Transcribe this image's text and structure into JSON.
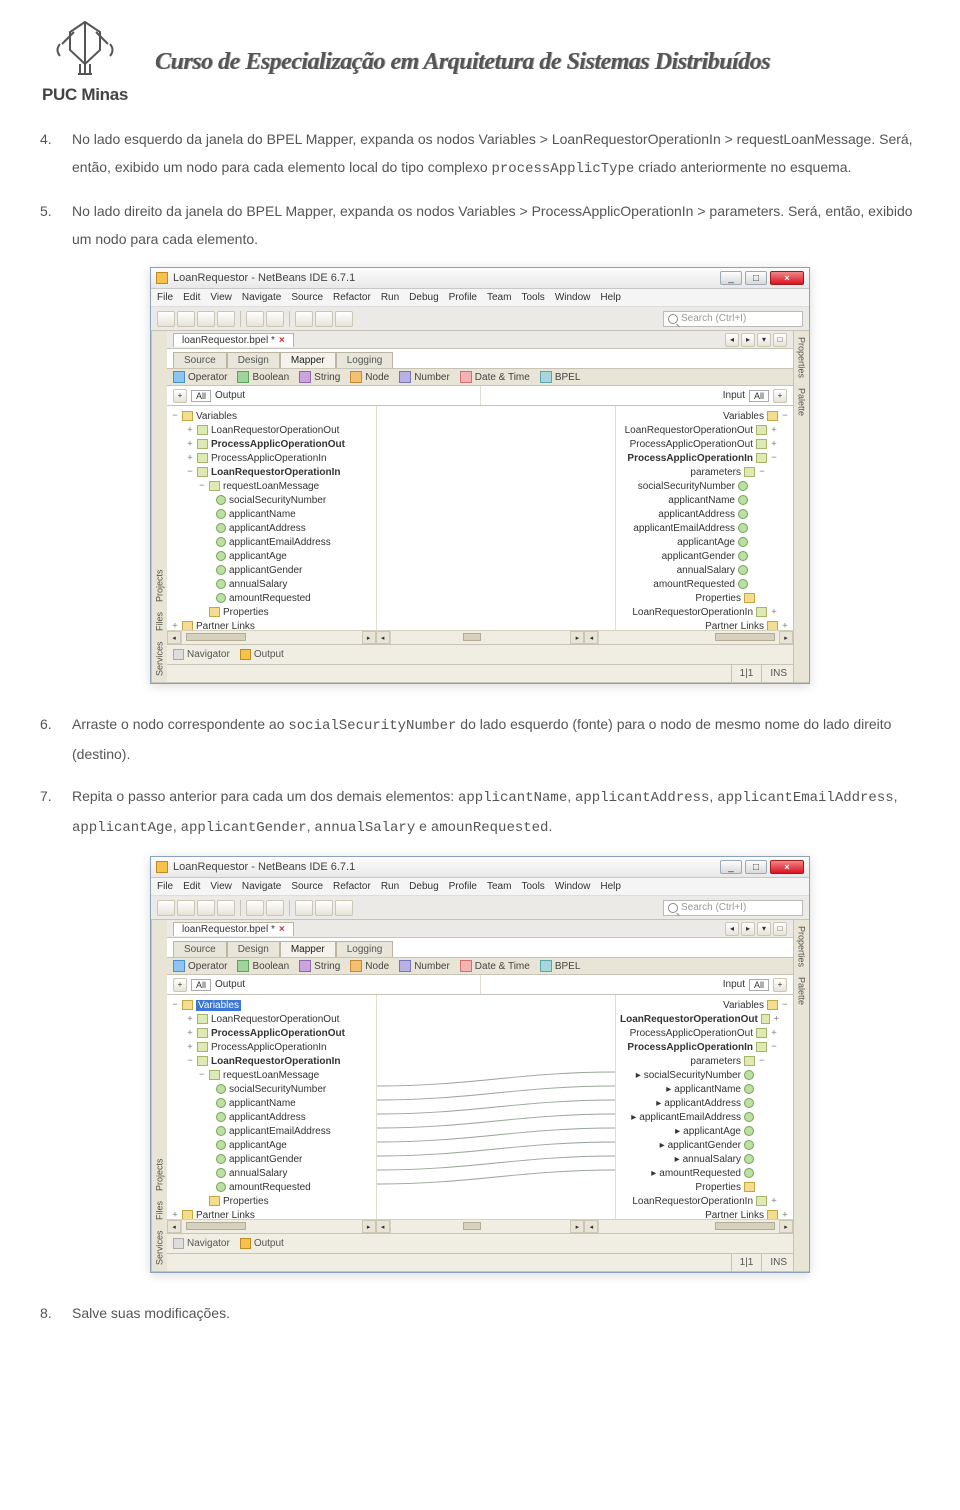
{
  "header": {
    "brand": "PUC Minas",
    "course_title": "Curso de Especialização em Arquitetura de Sistemas Distribuídos"
  },
  "steps": {
    "s4": {
      "num": "4.",
      "t1": "No lado esquerdo da janela do BPEL Mapper, expanda os nodos Variables > LoanRequestorOperationIn > requestLoanMessage. Será, então, exibido um nodo para cada elemento local do tipo complexo ",
      "code1": "processApplicType",
      "t2": " criado anteriormente no esquema."
    },
    "s5": {
      "num": "5.",
      "t1": "No lado direito da janela do BPEL Mapper, expanda os nodos Variables > ProcessApplicOperationIn > parameters. Será, então, exibido um nodo para cada elemento."
    },
    "s6": {
      "num": "6.",
      "t1": "Arraste o nodo correspondente ao ",
      "code1": "socialSecurityNumber",
      "t2": " do lado esquerdo (fonte) para o nodo de mesmo nome do lado direito (destino)."
    },
    "s7": {
      "num": "7.",
      "t1": "Repita o passo anterior para cada um dos demais elementos: ",
      "code1": "applicantName",
      "sep1": ", ",
      "code2": "applicantAddress",
      "sep2": ", ",
      "code3": "applicantEmailAddress",
      "sep3": ", ",
      "code4": "applicantAge",
      "sep4": ", ",
      "code5": "applicantGender",
      "sep5": ", ",
      "code6": "annualSalary",
      "sep6": " e ",
      "code7": "amounRequested",
      "end": "."
    },
    "s8": {
      "num": "8.",
      "t1": "Salve suas modificações."
    }
  },
  "nb": {
    "title": "LoanRequestor - NetBeans IDE 6.7.1",
    "menus": [
      "File",
      "Edit",
      "View",
      "Navigate",
      "Source",
      "Refactor",
      "Run",
      "Debug",
      "Profile",
      "Team",
      "Tools",
      "Window",
      "Help"
    ],
    "search_placeholder": "Search (Ctrl+I)",
    "file_tab": "loanRequestor.bpel *",
    "view_tabs": [
      "Source",
      "Design",
      "Mapper",
      "Logging"
    ],
    "tool_tabs": [
      "Operator",
      "Boolean",
      "String",
      "Node",
      "Number",
      "Date & Time",
      "BPEL"
    ],
    "map_hdr_left_lbl": "Output",
    "map_hdr_right_lbl": "Input",
    "map_hdr_dd": "All",
    "sidebar_left": [
      "Services",
      "Files",
      "Projects"
    ],
    "sidebar_right": [
      "Properties",
      "Palette"
    ],
    "left_tree": {
      "root": "Variables",
      "items": [
        "LoanRequestorOperationOut",
        "ProcessApplicOperationOut",
        "ProcessApplicOperationIn",
        "LoanRequestorOperationIn"
      ],
      "msg": "requestLoanMessage",
      "fields": [
        "socialSecurityNumber",
        "applicantName",
        "applicantAddress",
        "applicantEmailAddress",
        "applicantAge",
        "applicantGender",
        "annualSalary",
        "amountRequested"
      ],
      "props": "Properties",
      "partner": "Partner Links"
    },
    "right_tree": {
      "root": "Variables",
      "items": [
        "LoanRequestorOperationOut",
        "ProcessApplicOperationOut",
        "ProcessApplicOperationIn"
      ],
      "msg": "parameters",
      "fields": [
        "socialSecurityNumber",
        "applicantName",
        "applicantAddress",
        "applicantEmailAddress",
        "applicantAge",
        "applicantGender",
        "annualSalary",
        "amountRequested"
      ],
      "props": "Properties",
      "extra": "LoanRequestorOperationIn",
      "partner": "Partner Links"
    },
    "bottom_tabs": {
      "nav": "Navigator",
      "out": "Output"
    },
    "status": {
      "pos": "1|1",
      "ins": "INS"
    }
  }
}
